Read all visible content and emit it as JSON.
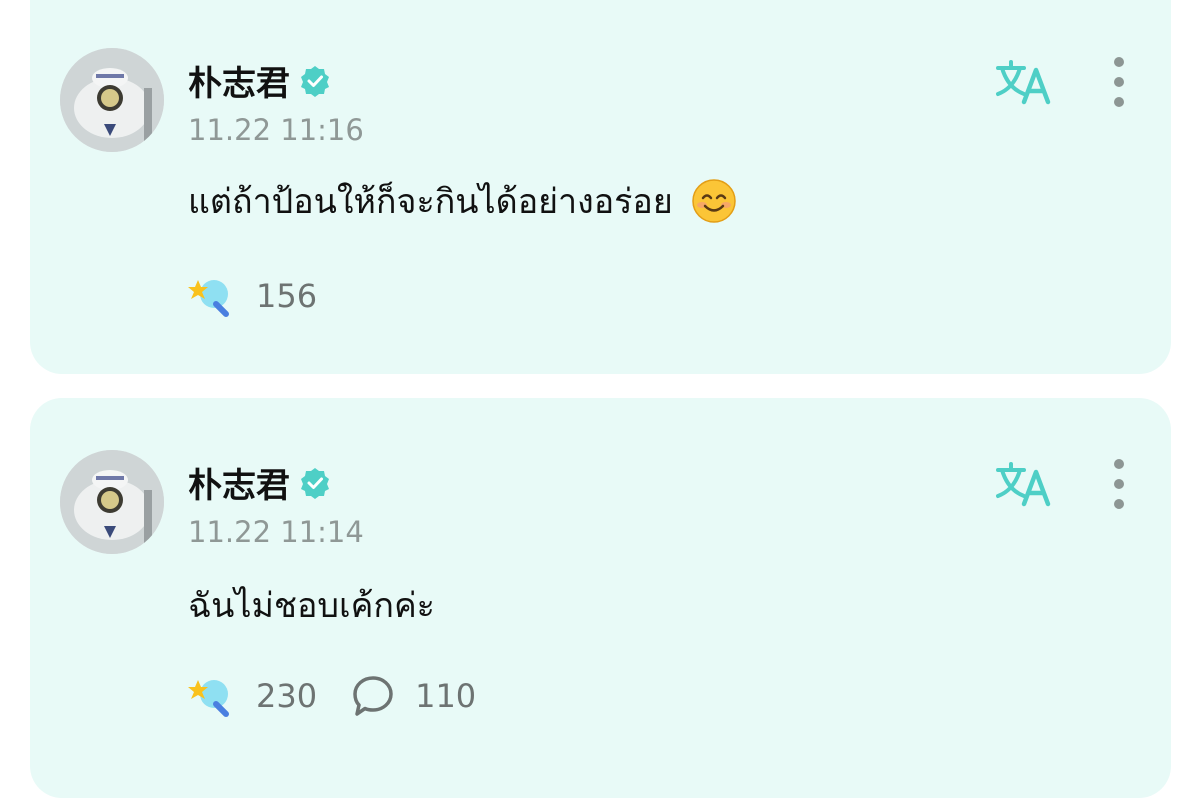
{
  "posts": [
    {
      "author": "朴志君",
      "time": "11.22 11:16",
      "text": "แต่ถ้าป้อนให้ก็จะกินได้อย่างอร่อย",
      "has_emoji": true,
      "emoji": "smiling-face-icon",
      "likes": "156",
      "comments": null
    },
    {
      "author": "朴志君",
      "time": "11.22 11:14",
      "text": "ฉันไม่ชอบเค้กค่ะ",
      "has_emoji": false,
      "likes": "230",
      "comments": "110"
    }
  ],
  "colors": {
    "card_bg": "#e8faf7",
    "accent": "#4ecfc6",
    "muted_text": "#8f9896"
  },
  "icons": {
    "verified": "verified-badge-icon",
    "translate": "translate-icon",
    "more": "more-vertical-icon",
    "like": "star-wand-icon",
    "comment": "comment-bubble-icon"
  }
}
